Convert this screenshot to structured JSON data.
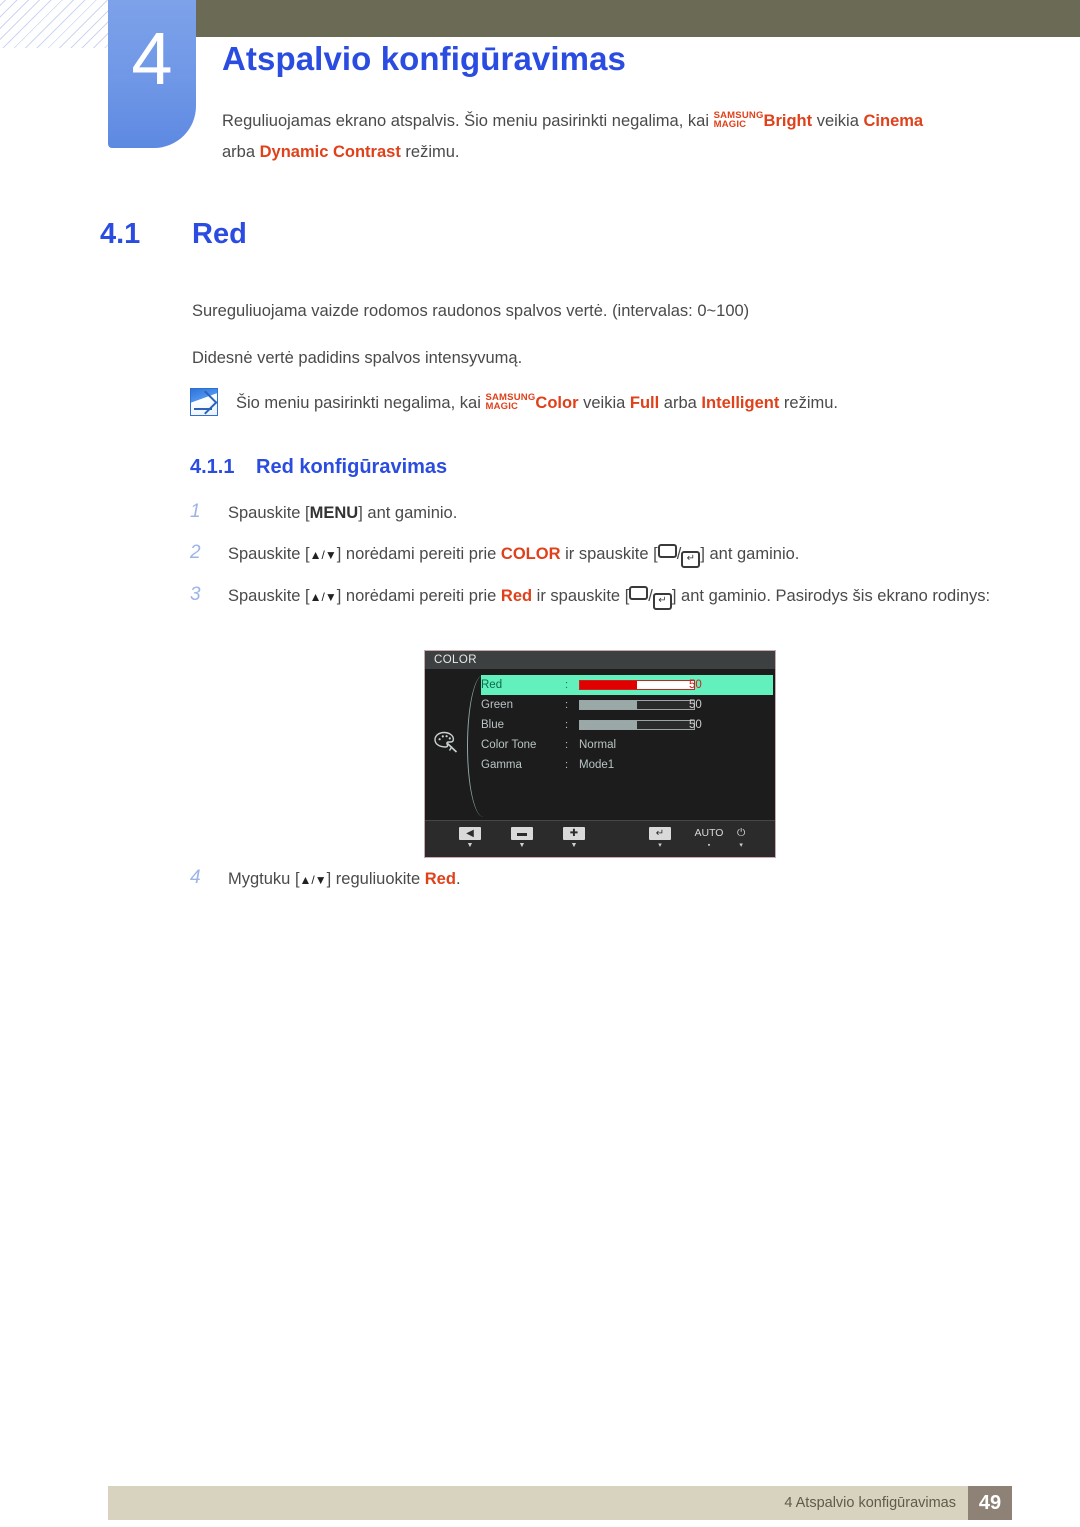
{
  "chapter": {
    "number": "4",
    "title": "Atspalvio konfigūravimas",
    "intro_prefix": "Reguliuojamas ekrano atspalvis. Šio meniu pasirinkti negalima, kai ",
    "magic_top": "SAMSUNG",
    "magic_bottom": "MAGIC",
    "intro_bright": "Bright",
    "intro_mid": " veikia ",
    "intro_cinema": "Cinema",
    "intro_line2_prefix": "arba ",
    "intro_dynamic_contrast": "Dynamic Contrast",
    "intro_line2_suffix": " režimu."
  },
  "section": {
    "number": "4.1",
    "title": "Red",
    "paragraph_1": "Sureguliuojama vaizde rodomos raudonos spalvos vertė. (intervalas: 0~100)",
    "paragraph_2": "Didesnė vertė padidins spalvos intensyvumą."
  },
  "note": {
    "icon": "note-pencil-icon",
    "prefix": "Šio meniu pasirinkti negalima, kai ",
    "magic_top": "SAMSUNG",
    "magic_bottom": "MAGIC",
    "color_word": "Color",
    "mid": " veikia ",
    "full": "Full",
    "arba": " arba ",
    "intelligent": "Intelligent",
    "suffix": " režimu."
  },
  "subsection": {
    "number": "4.1.1",
    "title": "Red konfigūravimas"
  },
  "steps": [
    {
      "num": "1",
      "t1": "Spauskite [",
      "key": "MENU",
      "t2": "] ant gaminio."
    },
    {
      "num": "2",
      "t1": "Spauskite [",
      "arrows": "▲/▼",
      "t2": "] norėdami pereiti prie ",
      "target": "COLOR",
      "t3": " ir spauskite [",
      "t4": "] ant gaminio."
    },
    {
      "num": "3",
      "t1": "Spauskite [",
      "arrows": "▲/▼",
      "t2": "] norėdami pereiti prie ",
      "target": "Red",
      "t3": " ir spauskite [",
      "t4": "] ant gaminio. Pasirodys šis ekrano rodinys:"
    },
    {
      "num": "4",
      "t1": "Mygtuku [",
      "arrows": "▲/▼",
      "t2": "] reguliuokite ",
      "target": "Red",
      "t3": "."
    }
  ],
  "osd": {
    "title": "COLOR",
    "icon": "palette-icon",
    "rows": [
      {
        "label": "Red",
        "colon": ":",
        "type": "bar",
        "value": "50",
        "selected": true
      },
      {
        "label": "Green",
        "colon": ":",
        "type": "bar",
        "value": "50",
        "selected": false
      },
      {
        "label": "Blue",
        "colon": ":",
        "type": "bar",
        "value": "50",
        "selected": false
      },
      {
        "label": "Color Tone",
        "colon": ":",
        "type": "text",
        "value": "Normal",
        "selected": false
      },
      {
        "label": "Gamma",
        "colon": ":",
        "type": "text",
        "value": "Mode1",
        "selected": false
      }
    ],
    "buttons": [
      {
        "name": "back-button",
        "glyph": "◀",
        "tick": "▼",
        "boxed": true
      },
      {
        "name": "minus-button",
        "glyph": "▬",
        "tick": "▼",
        "boxed": true
      },
      {
        "name": "plus-button",
        "glyph": "✚",
        "tick": "▼",
        "boxed": true
      },
      {
        "name": "enter-button",
        "glyph": "↵",
        "tick": "▾",
        "boxed": true
      },
      {
        "name": "auto-button",
        "glyph": "AUTO",
        "tick": "▪",
        "boxed": false
      },
      {
        "name": "power-button",
        "glyph": "⏻",
        "tick": "▾",
        "boxed": false
      }
    ]
  },
  "footer": {
    "text": "4 Atspalvio konfigūravimas",
    "page": "49"
  },
  "colors": {
    "heading_blue": "#2b4ce0",
    "accent_orange": "#e0401a",
    "tab_blue": "#6f97e6",
    "olive": "#6b6a55",
    "footer_beige": "#d8d3bf",
    "footer_page_box": "#8d8275",
    "osd_highlight": "#62f0bc",
    "osd_red": "#e00000"
  }
}
